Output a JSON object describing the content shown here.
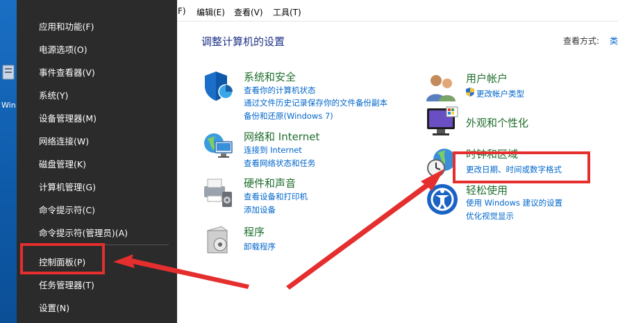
{
  "desktop": {
    "icon_label": "Win"
  },
  "menubar": {
    "items": [
      "F)",
      "编辑(E)",
      "查看(V)",
      "工具(T)"
    ]
  },
  "control_panel": {
    "title": "调整计算机的设置",
    "view_by_label": "查看方式:",
    "view_by_value": "类",
    "categories": [
      {
        "title": "系统和安全",
        "links": [
          "查看你的计算机状态",
          "通过文件历史记录保存你的文件备份副本",
          "备份和还原(Windows 7)"
        ]
      },
      {
        "title": "网络和 Internet",
        "links": [
          "连接到 Internet",
          "查看网络状态和任务"
        ]
      },
      {
        "title": "硬件和声音",
        "links": [
          "查看设备和打印机",
          "添加设备"
        ]
      },
      {
        "title": "程序",
        "links": [
          "卸载程序"
        ]
      },
      {
        "title": "用户帐户",
        "links": [
          "更改帐户类型"
        ]
      },
      {
        "title": "外观和个性化",
        "links": []
      },
      {
        "title": "时钟和区域",
        "links": [
          "更改日期、时间或数字格式"
        ]
      },
      {
        "title": "轻松使用",
        "links": [
          "使用 Windows 建议的设置",
          "优化视觉显示"
        ]
      }
    ]
  },
  "winx_menu": {
    "items": [
      "应用和功能(F)",
      "电源选项(O)",
      "事件查看器(V)",
      "系统(Y)",
      "设备管理器(M)",
      "网络连接(W)",
      "磁盘管理(K)",
      "计算机管理(G)",
      "命令提示符(C)",
      "命令提示符(管理员)(A)",
      "控制面板(P)",
      "任务管理器(T)",
      "设置(N)"
    ]
  },
  "colors": {
    "annotation": "#e52e2e",
    "link": "#0066cc",
    "category": "#1e6d2b",
    "menu_bg": "#2b2b2b"
  }
}
